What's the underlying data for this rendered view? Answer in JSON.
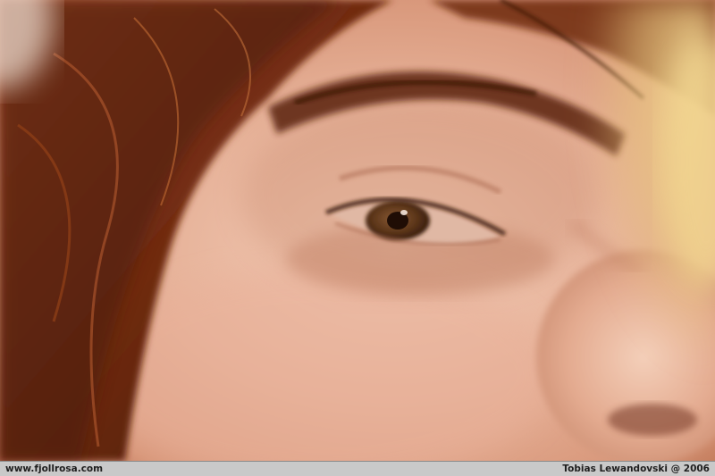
{
  "photo": {
    "subject": "close-up-face-eye",
    "palette": {
      "skin": "#e7b39a",
      "skin_light": "#f1c9b4",
      "skin_shadow": "#c98a6e",
      "hair": "#7a2f12",
      "hair_dark": "#4a1a08",
      "iris": "#5a3418",
      "pupil": "#1f0d05",
      "sclera": "#d9b3a0",
      "blur_yellow": "#f2d690"
    }
  },
  "footer": {
    "website": "www.fjollrosa.com",
    "credit": "Tobias Lewandovski @ 2006"
  }
}
